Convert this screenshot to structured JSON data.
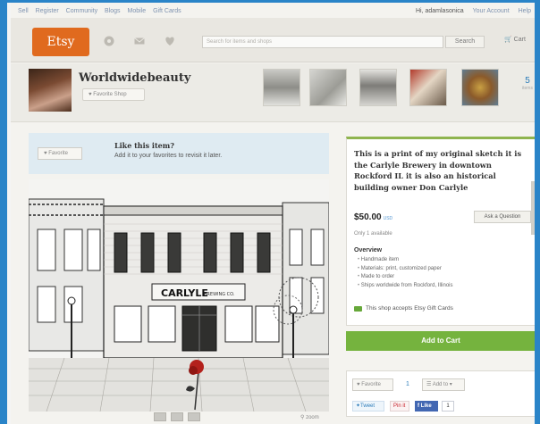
{
  "topnav": {
    "left": [
      "Sell",
      "Register",
      "Community",
      "Blogs",
      "Mobile",
      "Gift Cards"
    ],
    "greeting": "Hi, adamlasonica",
    "account": "Your Account",
    "help": "Help"
  },
  "header": {
    "logo": "Etsy",
    "search_placeholder": "Search for items and shops",
    "search_button": "Search",
    "cart": "Cart",
    "icons": [
      "compass-icon",
      "mail-icon",
      "heart-icon"
    ]
  },
  "shop": {
    "name": "Worldwidebeauty",
    "favorite_label": "Favorite Shop",
    "item_count": "5",
    "item_count_label": "items"
  },
  "favorite_prompt": {
    "button": "Favorite",
    "title": "Like this item?",
    "subtitle": "Add it to your favorites to revisit it later."
  },
  "artwork": {
    "sign": "CARLYLE",
    "sign_small": "BREWING CO."
  },
  "gallery": {
    "zoom": "zoom"
  },
  "listing": {
    "title": "This is a print of my original sketch it is the Carlyle Brewery in downtown Rockford IL it is also an historical building owner Don Carlyle",
    "price": "$50.00",
    "currency": "USD",
    "ask": "Ask a Question",
    "availability": "Only 1 available",
    "overview_title": "Overview",
    "overview": [
      "Handmade item",
      "Materials: print, customized paper",
      "Made to order",
      "Ships worldwide from Rockford, Illinois"
    ],
    "gift": "This shop accepts Etsy Gift Cards",
    "add_to_cart": "Add to Cart"
  },
  "social": {
    "favorite": "Favorite",
    "favorite_count": "1",
    "add_to": "Add to",
    "tweet": "Tweet",
    "pin": "Pin it",
    "like": "Like",
    "like_count": "1"
  },
  "colors": {
    "brand": "#e06a1e",
    "accent": "#75b33e",
    "link": "#2b7bb9"
  }
}
